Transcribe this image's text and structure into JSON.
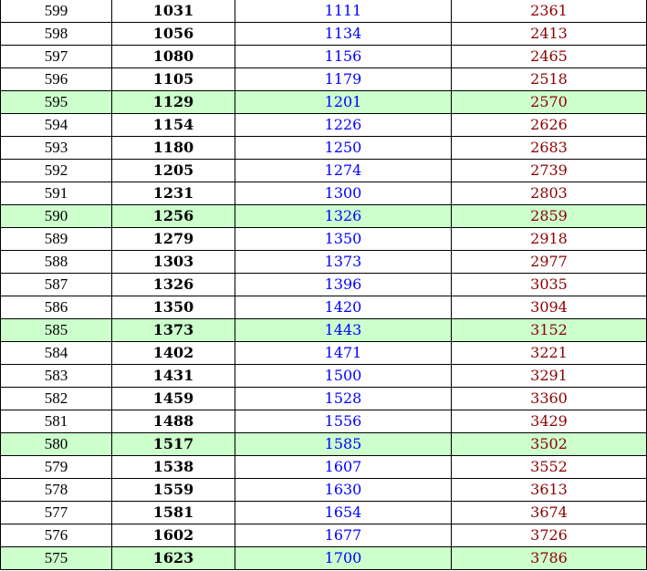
{
  "table": {
    "rows": [
      {
        "score": "599",
        "a": "1031",
        "b": "1111",
        "c": "2361",
        "highlight": false
      },
      {
        "score": "598",
        "a": "1056",
        "b": "1134",
        "c": "2413",
        "highlight": false
      },
      {
        "score": "597",
        "a": "1080",
        "b": "1156",
        "c": "2465",
        "highlight": false
      },
      {
        "score": "596",
        "a": "1105",
        "b": "1179",
        "c": "2518",
        "highlight": false
      },
      {
        "score": "595",
        "a": "1129",
        "b": "1201",
        "c": "2570",
        "highlight": true
      },
      {
        "score": "594",
        "a": "1154",
        "b": "1226",
        "c": "2626",
        "highlight": false
      },
      {
        "score": "593",
        "a": "1180",
        "b": "1250",
        "c": "2683",
        "highlight": false
      },
      {
        "score": "592",
        "a": "1205",
        "b": "1274",
        "c": "2739",
        "highlight": false
      },
      {
        "score": "591",
        "a": "1231",
        "b": "1300",
        "c": "2803",
        "highlight": false
      },
      {
        "score": "590",
        "a": "1256",
        "b": "1326",
        "c": "2859",
        "highlight": true
      },
      {
        "score": "589",
        "a": "1279",
        "b": "1350",
        "c": "2918",
        "highlight": false
      },
      {
        "score": "588",
        "a": "1303",
        "b": "1373",
        "c": "2977",
        "highlight": false
      },
      {
        "score": "587",
        "a": "1326",
        "b": "1396",
        "c": "3035",
        "highlight": false
      },
      {
        "score": "586",
        "a": "1350",
        "b": "1420",
        "c": "3094",
        "highlight": false
      },
      {
        "score": "585",
        "a": "1373",
        "b": "1443",
        "c": "3152",
        "highlight": true
      },
      {
        "score": "584",
        "a": "1402",
        "b": "1471",
        "c": "3221",
        "highlight": false
      },
      {
        "score": "583",
        "a": "1431",
        "b": "1500",
        "c": "3291",
        "highlight": false
      },
      {
        "score": "582",
        "a": "1459",
        "b": "1528",
        "c": "3360",
        "highlight": false
      },
      {
        "score": "581",
        "a": "1488",
        "b": "1556",
        "c": "3429",
        "highlight": false
      },
      {
        "score": "580",
        "a": "1517",
        "b": "1585",
        "c": "3502",
        "highlight": true
      },
      {
        "score": "579",
        "a": "1538",
        "b": "1607",
        "c": "3552",
        "highlight": false
      },
      {
        "score": "578",
        "a": "1559",
        "b": "1630",
        "c": "3613",
        "highlight": false
      },
      {
        "score": "577",
        "a": "1581",
        "b": "1654",
        "c": "3674",
        "highlight": false
      },
      {
        "score": "576",
        "a": "1602",
        "b": "1677",
        "c": "3726",
        "highlight": false
      },
      {
        "score": "575",
        "a": "1623",
        "b": "1700",
        "c": "3786",
        "highlight": true
      }
    ]
  },
  "colors": {
    "highlight_row": "#ccffcc",
    "column_2_text": "#0000ff",
    "column_3_text": "#8b0000",
    "column_1_text": "#000000"
  }
}
